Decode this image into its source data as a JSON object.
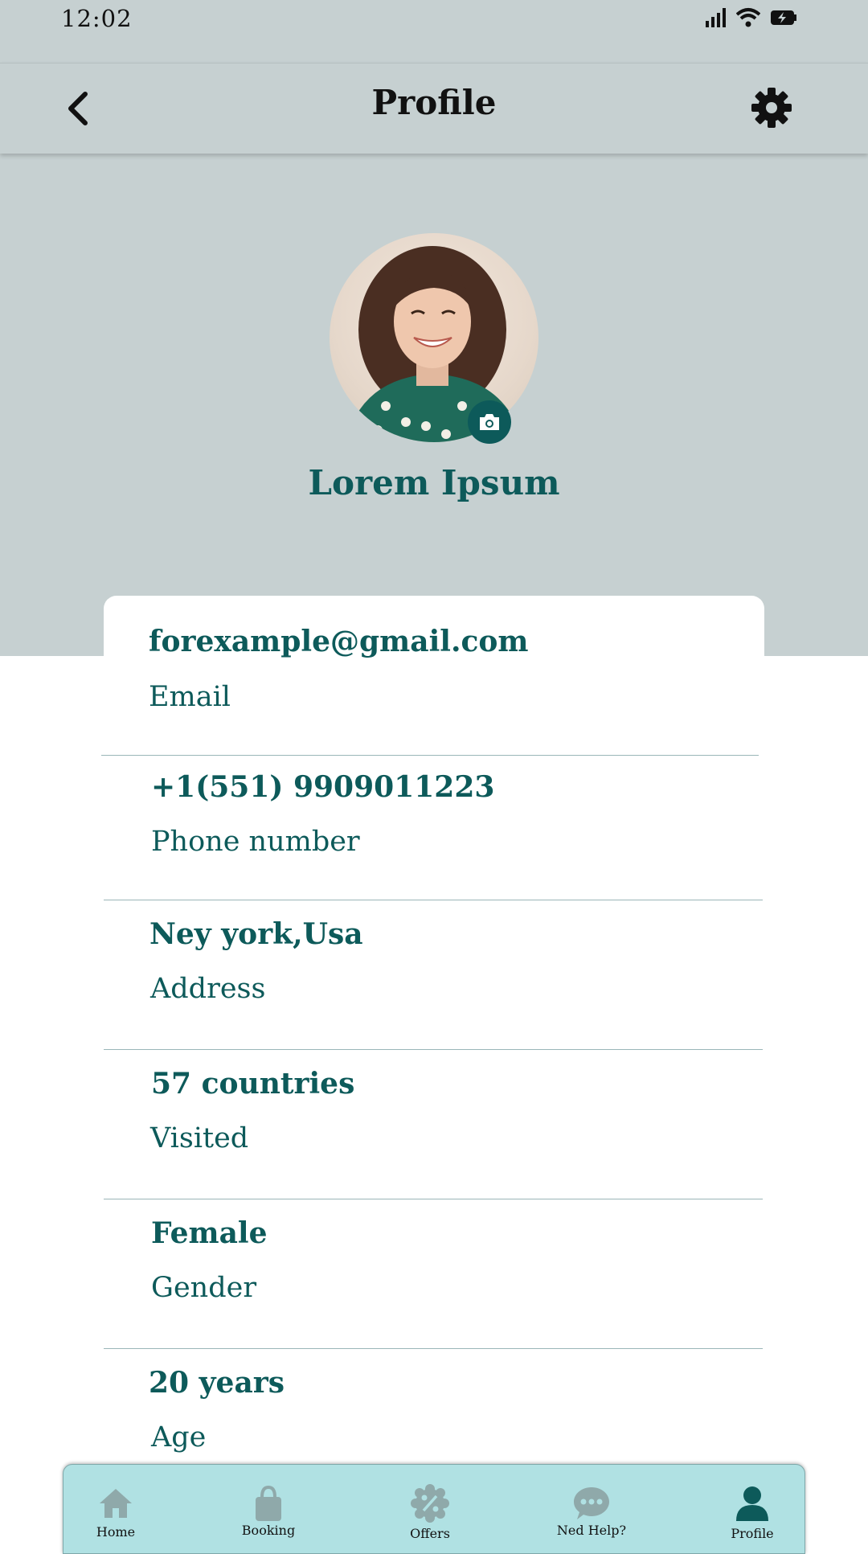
{
  "status_bar": {
    "time": "12:02",
    "icons": [
      "signal-icon",
      "wifi-icon",
      "battery-charging-icon"
    ]
  },
  "header": {
    "title": "Profile",
    "back_icon": "chevron-left-icon",
    "settings_icon": "gear-icon"
  },
  "profile": {
    "name": "Lorem Ipsum",
    "avatar": "avatar",
    "camera_icon": "camera-icon"
  },
  "info": [
    {
      "value": "forexample@gmail.com",
      "label": "Email"
    },
    {
      "value": "+1(551)  9909011223",
      "label": "Phone number"
    },
    {
      "value": "Ney york,Usa",
      "label": "Address"
    },
    {
      "value": "57 countries",
      "label": "Visited"
    },
    {
      "value": "Female",
      "label": "Gender"
    },
    {
      "value": "20 years",
      "label": "Age"
    }
  ],
  "bottom_nav": {
    "items": [
      {
        "label": "Home",
        "icon": "home-icon",
        "active": false
      },
      {
        "label": "Booking",
        "icon": "shopping-bag-icon",
        "active": false
      },
      {
        "label": "Offers",
        "icon": "percent-badge-icon",
        "active": false
      },
      {
        "label": "Ned Help?",
        "icon": "chat-bubble-icon",
        "active": false
      },
      {
        "label": "Profile",
        "icon": "user-icon",
        "active": true
      }
    ]
  },
  "colors": {
    "header_bg": "#c6d0d1",
    "accent": "#0d5a5a",
    "nav_bg": "#b0e1e3",
    "nav_inactive": "#8fa9aa"
  }
}
